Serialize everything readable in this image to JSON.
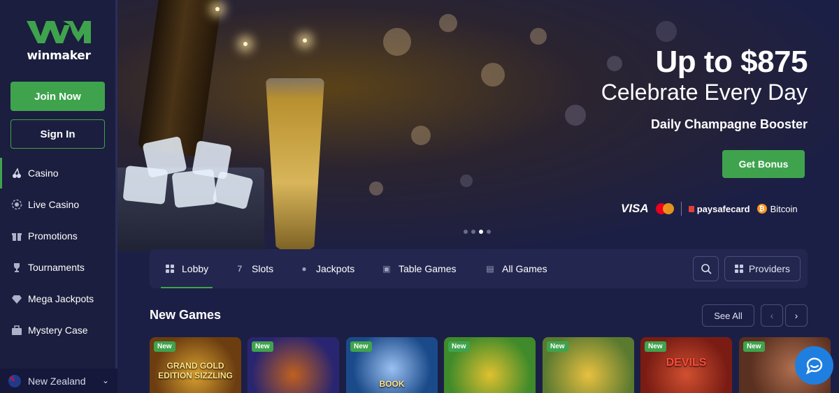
{
  "brand": {
    "name": "winmaker",
    "accent": "#3fa34d"
  },
  "auth": {
    "join_label": "Join Now",
    "signin_label": "Sign In"
  },
  "nav": {
    "items": [
      {
        "label": "Casino",
        "icon": "cherries-icon",
        "active": true
      },
      {
        "label": "Live Casino",
        "icon": "chip-icon"
      },
      {
        "label": "Promotions",
        "icon": "gift-icon"
      },
      {
        "label": "Tournaments",
        "icon": "trophy-icon"
      },
      {
        "label": "Mega Jackpots",
        "icon": "diamond-icon"
      },
      {
        "label": "Mystery Case",
        "icon": "briefcase-icon"
      }
    ]
  },
  "region": {
    "label": "New Zealand",
    "icon": "nz-flag-icon"
  },
  "hero": {
    "title": "Up to $875",
    "subtitle": "Celebrate Every Day",
    "description": "Daily Champagne Booster",
    "cta_label": "Get Bonus",
    "payments": {
      "visa": "VISA",
      "paysafecard": "paysafecard",
      "bitcoin": "Bitcoin"
    },
    "slides_total": 4,
    "active_slide": 3
  },
  "tabs": [
    {
      "label": "Lobby",
      "icon": "lobby-icon",
      "active": true
    },
    {
      "label": "Slots",
      "icon": "seven-icon"
    },
    {
      "label": "Jackpots",
      "icon": "pot-icon"
    },
    {
      "label": "Table Games",
      "icon": "cards-icon"
    },
    {
      "label": "All Games",
      "icon": "all-games-icon"
    }
  ],
  "toolbar": {
    "providers_label": "Providers"
  },
  "new_games": {
    "title": "New Games",
    "see_all_label": "See All",
    "badge_label": "New",
    "games": [
      {
        "title": "GRAND GOLD EDITION SIZZLING",
        "color": "#6b3d10"
      },
      {
        "title": "",
        "color": "#2a2570"
      },
      {
        "title": "BOOK",
        "color": "#1b4a8a"
      },
      {
        "title": "",
        "color": "#3f8a2a"
      },
      {
        "title": "",
        "color": "#8a7a20"
      },
      {
        "title": "DEVILS",
        "color": "#7a1c14"
      },
      {
        "title": "",
        "color": "#5a3020"
      }
    ]
  }
}
